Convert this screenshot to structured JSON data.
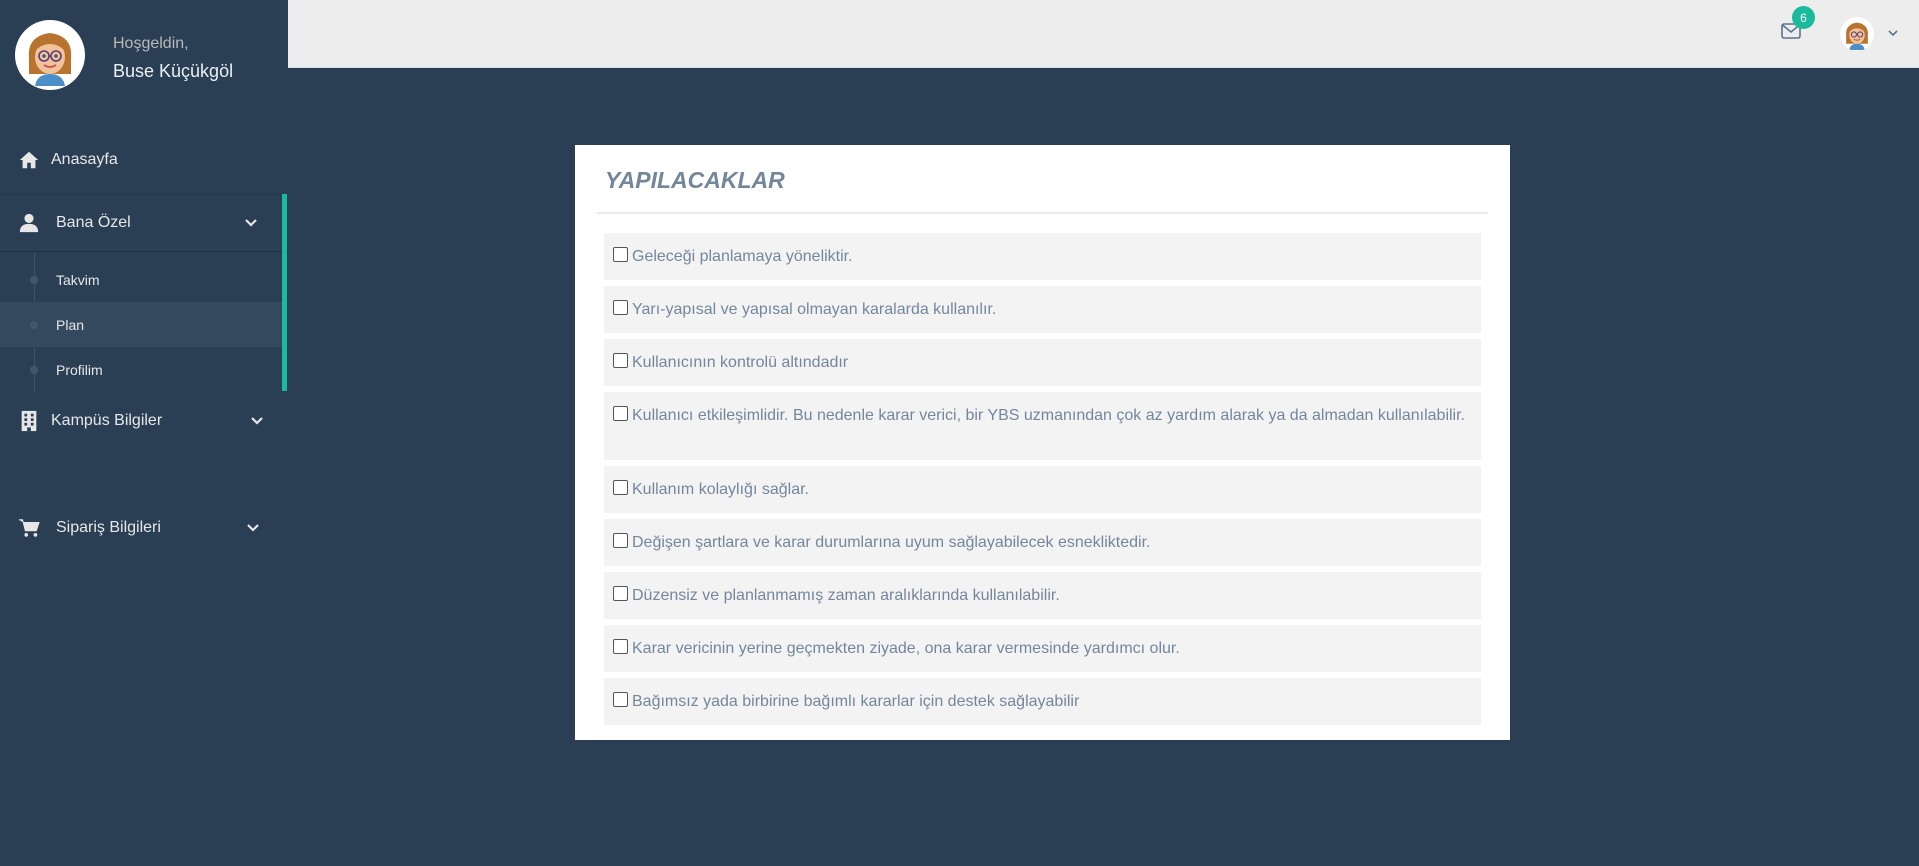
{
  "sidebar": {
    "welcome": "Hoşgeldin,",
    "username": "Buse Küçükgöl",
    "menu": {
      "home": "Anasayfa",
      "bana_ozel": "Bana Özel",
      "bana_ozel_sub": [
        "Takvim",
        "Plan",
        "Profilim"
      ],
      "kampus": "Kampüs Bilgiler",
      "siparis": "Sipariş Bilgileri"
    },
    "active_sub": "Plan",
    "accent_color": "#1abb9c"
  },
  "topnav": {
    "notification_count": "6",
    "icons": [
      "envelope-icon",
      "user-avatar",
      "chevron-down-icon"
    ]
  },
  "panel": {
    "title": "YAPILACAKLAR",
    "todos": [
      "Geleceği planlamaya yöneliktir.",
      "Yarı-yapısal ve yapısal olmayan karalarda kullanılır.",
      "Kullanıcının kontrolü altındadır",
      "Kullanıcı etkileşimlidir. Bu nedenle karar verici, bir YBS uzmanından çok az yardım alarak ya da almadan kullanılabilir.",
      "Kullanım kolaylığı sağlar.",
      "Değişen şartlara ve karar durumlarına uyum sağlayabilecek esnekliktedir.",
      "Düzensiz ve planlanmamış zaman aralıklarında kullanılabilir.",
      "Karar vericinin yerine geçmekten ziyade, ona karar vermesinde yardımcı olur.",
      "Bağımsız yada birbirine bağımlı kararlar için destek sağlayabilir"
    ]
  },
  "colors": {
    "sidebar_bg": "#2a3f54",
    "topbar_bg": "#ededed",
    "panel_text": "#73879c",
    "todo_bg": "#f3f3f3"
  }
}
